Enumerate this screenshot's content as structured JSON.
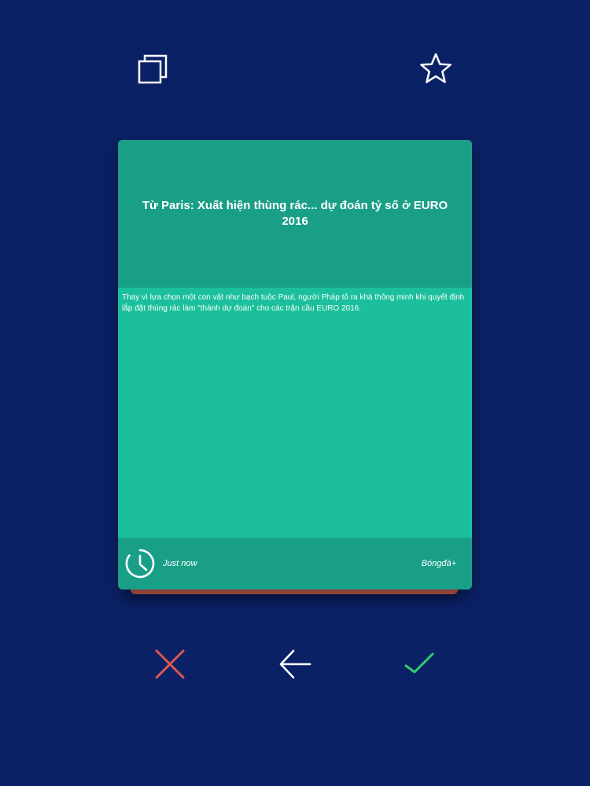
{
  "toolbar": {
    "copy_icon": "copy-icon",
    "star_icon": "star-icon"
  },
  "card": {
    "title": "Từ Paris: Xuất hiện thùng rác... dự đoán tỷ số ở EURO 2016",
    "description": "Thay vì lựa chọn một con vật như bạch tuộc Paul, người Pháp tỏ ra khá thông minh khi quyết định lắp đặt thùng rác làm \"thánh dự đoán\" cho các trận cầu EURO 2016.",
    "time": "Just now",
    "source": "Bóngđá+"
  },
  "actions": {
    "dismiss_icon": "close-icon",
    "back_icon": "arrow-left-icon",
    "accept_icon": "check-icon"
  },
  "colors": {
    "background": "#0b2165",
    "card_body": "#1bbf9b",
    "card_header": "#1a9f87",
    "stack_back": "#c0574a",
    "dismiss": "#e0584d",
    "accept": "#2ecc71",
    "icon": "#ffffff"
  }
}
